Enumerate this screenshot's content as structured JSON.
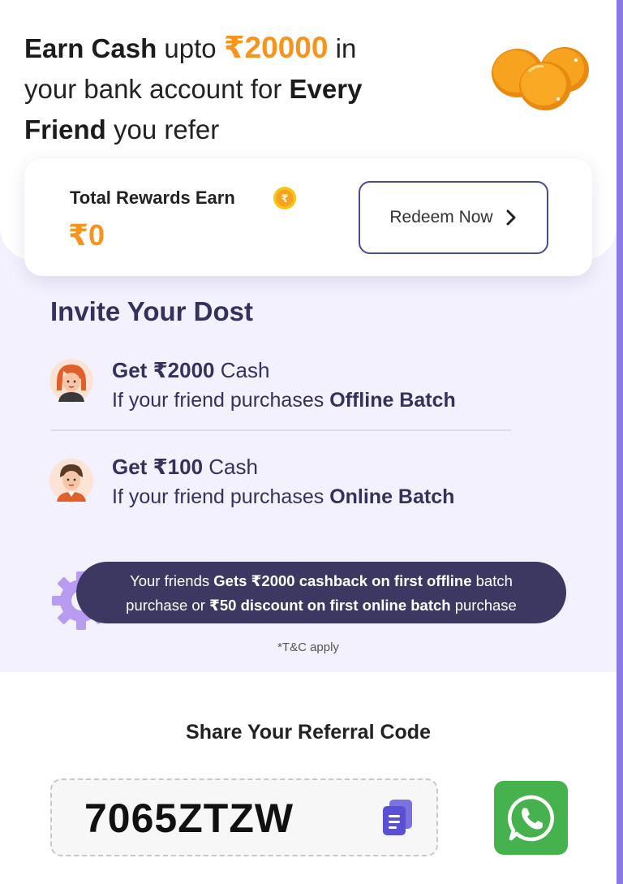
{
  "hero": {
    "line1_bold": "Earn Cash",
    "line1_mid": " upto ",
    "line1_amount": "₹20000",
    "line1_end": " in",
    "line2_start": "your bank account for ",
    "line2_bold": "Every",
    "line3_bold": "Friend",
    "line3_end": " you refer",
    "coins_icon": "gold-coins-icon"
  },
  "rewards": {
    "title": "Total Rewards Earn",
    "amount": "₹0",
    "coin_icon": "rupee-coin-icon",
    "redeem_label": "Redeem Now"
  },
  "invite": {
    "title": "Invite Your Dost",
    "items": [
      {
        "get_bold": "Get ₹2000",
        "get_end": " Cash",
        "desc_start": "If your friend purchases ",
        "desc_bold": "Offline Batch",
        "avatar_icon": "girl-avatar-icon"
      },
      {
        "get_bold": "Get ₹100",
        "get_end": " Cash",
        "desc_start": "If your friend purchases ",
        "desc_bold": "Online Batch",
        "avatar_icon": "boy-avatar-icon"
      }
    ]
  },
  "promo": {
    "p1": "Your friends ",
    "b1": "Gets ₹2000 cashback on first offline",
    "p2": " batch",
    "p3": "purchase or ",
    "b2": "₹50 discount on first online batch",
    "p4": " purchase",
    "tnc": "*T&C apply"
  },
  "share": {
    "title": "Share Your Referral Code",
    "code": "7065ZTZW",
    "copy_icon": "copy-icon",
    "whatsapp_icon": "whatsapp-icon"
  },
  "colors": {
    "accent_orange": "#f7941d",
    "navy": "#34315e",
    "lavender_bg": "#f3f1fd",
    "pill_bg": "#3c3862",
    "whatsapp_green": "#46b24e",
    "scrollbar": "#8b79e6"
  }
}
